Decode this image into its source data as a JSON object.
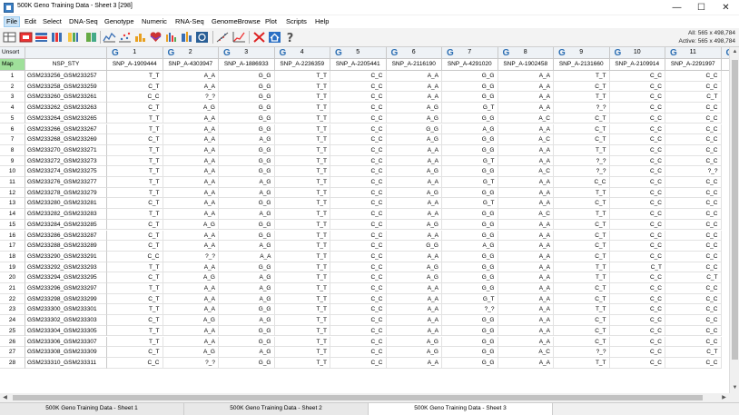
{
  "window": {
    "title": "500K Geno Training Data - Sheet 3 [298]",
    "min_glyph": "—",
    "max_glyph": "☐",
    "close_glyph": "✕"
  },
  "menu": [
    "File",
    "Edit",
    "Select",
    "DNA-Seq",
    "Genotype",
    "Numeric",
    "RNA-Seq",
    "GenomeBrowse",
    "Plot",
    "Scripts",
    "Help"
  ],
  "toolbar": {
    "icons": [
      "table-open-icon",
      "table-filter-icon",
      "table-sort-icon",
      "columns-icon",
      "spreadsheet-icon",
      "line-plot-icon",
      "scatter-plot-icon",
      "bar-chart-icon",
      "heart-icon",
      "histogram-icon",
      "xy-plot-icon",
      "genome-browser-icon",
      "qq-plot-icon",
      "trend-plot-icon",
      "close-red-icon",
      "home-icon",
      "help-icon"
    ],
    "all_count": "All: 565 x 498,784",
    "active_count": "Active: 565 x 498,784"
  },
  "grid": {
    "corner_top": "Unsort",
    "corner_bottom": "Map",
    "row_header_label": "NSP_STY",
    "column_type_glyph": "G",
    "columns": [
      {
        "num": "1",
        "name": "SNP_A-1909444"
      },
      {
        "num": "2",
        "name": "SNP_A-4303947"
      },
      {
        "num": "3",
        "name": "SNP_A-1886933"
      },
      {
        "num": "4",
        "name": "SNP_A-2236359"
      },
      {
        "num": "5",
        "name": "SNP_A-2205441"
      },
      {
        "num": "6",
        "name": "SNP_A-2116190"
      },
      {
        "num": "7",
        "name": "SNP_A-4291020"
      },
      {
        "num": "8",
        "name": "SNP_A-1902458"
      },
      {
        "num": "9",
        "name": "SNP_A-2131660"
      },
      {
        "num": "10",
        "name": "SNP_A-2109914"
      },
      {
        "num": "11",
        "name": "SNP_A-2291997"
      },
      {
        "num": "12",
        "name": "S"
      }
    ],
    "rows": [
      {
        "n": "1",
        "id": "GSM233256_GSM233257",
        "v": [
          "T_T",
          "A_A",
          "G_G",
          "T_T",
          "C_C",
          "A_A",
          "G_G",
          "A_A",
          "T_T",
          "C_C",
          "C_C"
        ]
      },
      {
        "n": "2",
        "id": "GSM233258_GSM233259",
        "v": [
          "C_T",
          "A_A",
          "G_G",
          "T_T",
          "C_C",
          "A_A",
          "G_G",
          "A_A",
          "C_T",
          "C_C",
          "C_C"
        ]
      },
      {
        "n": "3",
        "id": "GSM233260_GSM233261",
        "v": [
          "C_C",
          "?_?",
          "G_G",
          "T_T",
          "C_C",
          "A_A",
          "G_G",
          "A_A",
          "T_T",
          "C_C",
          "C_T"
        ]
      },
      {
        "n": "4",
        "id": "GSM233262_GSM233263",
        "v": [
          "C_T",
          "A_G",
          "G_G",
          "T_T",
          "C_C",
          "A_G",
          "G_T",
          "A_A",
          "?_?",
          "C_C",
          "C_C"
        ]
      },
      {
        "n": "5",
        "id": "GSM233264_GSM233265",
        "v": [
          "T_T",
          "A_A",
          "G_G",
          "T_T",
          "C_C",
          "A_G",
          "G_G",
          "A_C",
          "C_T",
          "C_C",
          "C_C"
        ]
      },
      {
        "n": "6",
        "id": "GSM233266_GSM233267",
        "v": [
          "T_T",
          "A_A",
          "G_G",
          "T_T",
          "C_C",
          "G_G",
          "A_G",
          "A_A",
          "C_T",
          "C_C",
          "C_C"
        ]
      },
      {
        "n": "7",
        "id": "GSM233268_GSM233269",
        "v": [
          "C_T",
          "A_A",
          "A_G",
          "T_T",
          "C_C",
          "A_G",
          "G_G",
          "A_C",
          "C_T",
          "C_C",
          "C_C"
        ]
      },
      {
        "n": "8",
        "id": "GSM233270_GSM233271",
        "v": [
          "T_T",
          "A_A",
          "G_G",
          "T_T",
          "C_C",
          "A_A",
          "G_G",
          "A_A",
          "T_T",
          "C_C",
          "C_C"
        ]
      },
      {
        "n": "9",
        "id": "GSM233272_GSM233273",
        "v": [
          "T_T",
          "A_A",
          "G_G",
          "T_T",
          "C_C",
          "A_A",
          "G_T",
          "A_A",
          "?_?",
          "C_C",
          "C_C"
        ]
      },
      {
        "n": "10",
        "id": "GSM233274_GSM233275",
        "v": [
          "T_T",
          "A_A",
          "G_G",
          "T_T",
          "C_C",
          "A_G",
          "G_G",
          "A_C",
          "?_?",
          "C_C",
          "?_?"
        ]
      },
      {
        "n": "11",
        "id": "GSM233276_GSM233277",
        "v": [
          "T_T",
          "A_A",
          "A_G",
          "T_T",
          "C_C",
          "A_A",
          "G_T",
          "A_A",
          "C_C",
          "C_C",
          "C_C"
        ]
      },
      {
        "n": "12",
        "id": "GSM233278_GSM233279",
        "v": [
          "T_T",
          "A_A",
          "A_G",
          "T_T",
          "C_C",
          "A_G",
          "G_G",
          "A_A",
          "T_T",
          "C_C",
          "C_C"
        ]
      },
      {
        "n": "13",
        "id": "GSM233280_GSM233281",
        "v": [
          "C_T",
          "A_A",
          "G_G",
          "T_T",
          "C_C",
          "A_A",
          "G_T",
          "A_A",
          "C_T",
          "C_C",
          "C_C"
        ]
      },
      {
        "n": "14",
        "id": "GSM233282_GSM233283",
        "v": [
          "T_T",
          "A_A",
          "A_G",
          "T_T",
          "C_C",
          "A_A",
          "G_G",
          "A_C",
          "T_T",
          "C_C",
          "C_C"
        ]
      },
      {
        "n": "15",
        "id": "GSM233284_GSM233285",
        "v": [
          "C_T",
          "A_G",
          "G_G",
          "T_T",
          "C_C",
          "A_G",
          "G_G",
          "A_A",
          "C_T",
          "C_C",
          "C_C"
        ]
      },
      {
        "n": "16",
        "id": "GSM233286_GSM233287",
        "v": [
          "C_T",
          "A_A",
          "G_G",
          "T_T",
          "C_C",
          "A_A",
          "G_G",
          "A_A",
          "C_T",
          "C_C",
          "C_C"
        ]
      },
      {
        "n": "17",
        "id": "GSM233288_GSM233289",
        "v": [
          "C_T",
          "A_A",
          "A_G",
          "T_T",
          "C_C",
          "G_G",
          "A_G",
          "A_A",
          "C_T",
          "C_C",
          "C_C"
        ]
      },
      {
        "n": "18",
        "id": "GSM233290_GSM233291",
        "v": [
          "C_C",
          "?_?",
          "A_A",
          "T_T",
          "C_C",
          "A_A",
          "G_G",
          "A_A",
          "C_T",
          "C_C",
          "C_C"
        ]
      },
      {
        "n": "19",
        "id": "GSM233292_GSM233293",
        "v": [
          "T_T",
          "A_A",
          "G_G",
          "T_T",
          "C_C",
          "A_G",
          "G_G",
          "A_A",
          "T_T",
          "C_T",
          "C_C"
        ]
      },
      {
        "n": "20",
        "id": "GSM233294_GSM233295",
        "v": [
          "C_T",
          "A_G",
          "A_G",
          "T_T",
          "C_C",
          "A_G",
          "G_G",
          "A_A",
          "T_T",
          "C_C",
          "C_T"
        ]
      },
      {
        "n": "21",
        "id": "GSM233296_GSM233297",
        "v": [
          "T_T",
          "A_A",
          "A_G",
          "T_T",
          "C_C",
          "A_A",
          "G_G",
          "A_A",
          "C_T",
          "C_C",
          "C_C"
        ]
      },
      {
        "n": "22",
        "id": "GSM233298_GSM233299",
        "v": [
          "C_T",
          "A_A",
          "A_G",
          "T_T",
          "C_C",
          "A_A",
          "G_T",
          "A_A",
          "C_T",
          "C_C",
          "C_C"
        ]
      },
      {
        "n": "23",
        "id": "GSM233300_GSM233301",
        "v": [
          "T_T",
          "A_A",
          "G_G",
          "T_T",
          "C_C",
          "A_A",
          "?_?",
          "A_A",
          "T_T",
          "C_C",
          "C_C"
        ]
      },
      {
        "n": "24",
        "id": "GSM233302_GSM233303",
        "v": [
          "C_T",
          "A_G",
          "A_G",
          "T_T",
          "C_C",
          "A_A",
          "G_G",
          "A_A",
          "C_T",
          "C_C",
          "C_C"
        ]
      },
      {
        "n": "25",
        "id": "GSM233304_GSM233305",
        "v": [
          "T_T",
          "A_A",
          "G_G",
          "T_T",
          "C_C",
          "A_A",
          "G_G",
          "A_A",
          "C_T",
          "C_C",
          "C_C"
        ]
      },
      {
        "n": "26",
        "id": "GSM233306_GSM233307",
        "v": [
          "T_T",
          "A_A",
          "G_G",
          "T_T",
          "C_C",
          "A_G",
          "G_G",
          "A_A",
          "C_T",
          "C_C",
          "C_C"
        ]
      },
      {
        "n": "27",
        "id": "GSM233308_GSM233309",
        "v": [
          "C_T",
          "A_G",
          "A_G",
          "T_T",
          "C_C",
          "A_G",
          "G_G",
          "A_C",
          "?_?",
          "C_C",
          "C_T"
        ]
      },
      {
        "n": "28",
        "id": "GSM233310_GSM233311",
        "v": [
          "C_C",
          "?_?",
          "G_G",
          "T_T",
          "C_C",
          "A_A",
          "G_G",
          "A_A",
          "T_T",
          "C_C",
          "C_C"
        ]
      }
    ]
  },
  "tabs": [
    {
      "label": "500K Geno Training Data - Sheet 1",
      "active": false
    },
    {
      "label": "500K Geno Training Data - Sheet 2",
      "active": false
    },
    {
      "label": "500K Geno Training Data - Sheet 3",
      "active": true
    }
  ],
  "colors": {
    "genotype_marker": "#2d6fb3",
    "map_cell": "#9fe09a",
    "menu_active": "#cce4f7"
  }
}
